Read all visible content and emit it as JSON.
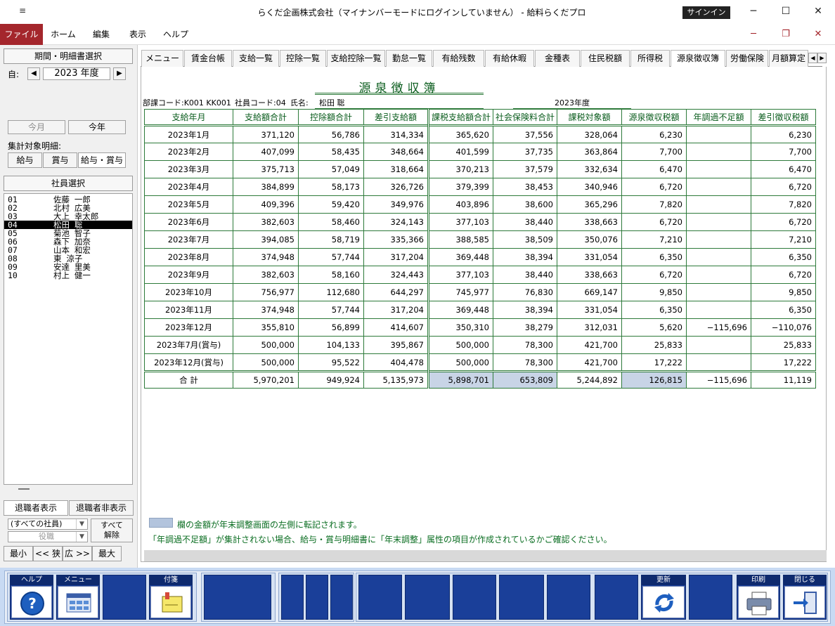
{
  "window": {
    "title": "らくだ企画株式会社（マイナンバーモードにログインしていません） - 給料らくだプロ",
    "signin": "サインイン",
    "qa_icon": "≡",
    "min": "─",
    "max": "☐",
    "close": "✕"
  },
  "menubar": {
    "items": [
      "ファイル",
      "ホーム",
      "編集",
      "表示",
      "ヘルプ"
    ],
    "mdi_min": "─",
    "mdi_restore": "❐",
    "mdi_close": "✕"
  },
  "left": {
    "period_header": "期間・明細書選択",
    "from_label": "自:",
    "year_value": "2023 年度",
    "prev": "◀",
    "next": "▶",
    "this_month": "今月",
    "this_year": "今年",
    "target_label": "集計対象明細:",
    "target_buttons": [
      "給与",
      "賞与",
      "給与・賞与"
    ],
    "employee_header": "社員選択",
    "employees": [
      {
        "code": "01",
        "name": "佐藤 一郎"
      },
      {
        "code": "02",
        "name": "北村 広美"
      },
      {
        "code": "03",
        "name": "大上 幸太郎"
      },
      {
        "code": "04",
        "name": "松田 聡"
      },
      {
        "code": "05",
        "name": "菊池 智子"
      },
      {
        "code": "06",
        "name": "森下 加奈"
      },
      {
        "code": "07",
        "name": "山本 和宏"
      },
      {
        "code": "08",
        "name": "東 涼子"
      },
      {
        "code": "09",
        "name": "安達 里美"
      },
      {
        "code": "10",
        "name": "村上 健一"
      }
    ],
    "show_retired": "退職者表示",
    "hide_retired": "退職者非表示",
    "filter_all": "(すべての社員)",
    "filter_role": "役職",
    "clear_all": "すべて\n解除",
    "size_buttons": [
      "最小",
      "<< 狭",
      "広 >>",
      "最大"
    ]
  },
  "tabs": [
    "メニュー",
    "賃金台帳",
    "支給一覧",
    "控除一覧",
    "支給控除一覧",
    "勤怠一覧",
    "有給残数",
    "有給休暇",
    "金種表",
    "住民税額",
    "所得税",
    "源泉徴収簿",
    "労働保険",
    "月額算定"
  ],
  "active_tab": "源泉徴収簿",
  "document": {
    "title": "源泉徴収簿",
    "dept": "部課コード:K001 KK001",
    "emp_code": "社員コード:04",
    "name_label": "氏名:",
    "name": "松田 聡",
    "year": "2023年度"
  },
  "table": {
    "headers": [
      "支給年月",
      "支給額合計",
      "控除額合計",
      "差引支給額",
      "課税支給額合計",
      "社会保険料合計",
      "課税対象額",
      "源泉徴収税額",
      "年調過不足額",
      "差引徴収税額"
    ],
    "rows": [
      [
        "2023年1月",
        "371,120",
        "56,786",
        "314,334",
        "365,620",
        "37,556",
        "328,064",
        "6,230",
        "",
        "6,230"
      ],
      [
        "2023年2月",
        "407,099",
        "58,435",
        "348,664",
        "401,599",
        "37,735",
        "363,864",
        "7,700",
        "",
        "7,700"
      ],
      [
        "2023年3月",
        "375,713",
        "57,049",
        "318,664",
        "370,213",
        "37,579",
        "332,634",
        "6,470",
        "",
        "6,470"
      ],
      [
        "2023年4月",
        "384,899",
        "58,173",
        "326,726",
        "379,399",
        "38,453",
        "340,946",
        "6,720",
        "",
        "6,720"
      ],
      [
        "2023年5月",
        "409,396",
        "59,420",
        "349,976",
        "403,896",
        "38,600",
        "365,296",
        "7,820",
        "",
        "7,820"
      ],
      [
        "2023年6月",
        "382,603",
        "58,460",
        "324,143",
        "377,103",
        "38,440",
        "338,663",
        "6,720",
        "",
        "6,720"
      ],
      [
        "2023年7月",
        "394,085",
        "58,719",
        "335,366",
        "388,585",
        "38,509",
        "350,076",
        "7,210",
        "",
        "7,210"
      ],
      [
        "2023年8月",
        "374,948",
        "57,744",
        "317,204",
        "369,448",
        "38,394",
        "331,054",
        "6,350",
        "",
        "6,350"
      ],
      [
        "2023年9月",
        "382,603",
        "58,160",
        "324,443",
        "377,103",
        "38,440",
        "338,663",
        "6,720",
        "",
        "6,720"
      ],
      [
        "2023年10月",
        "756,977",
        "112,680",
        "644,297",
        "745,977",
        "76,830",
        "669,147",
        "9,850",
        "",
        "9,850"
      ],
      [
        "2023年11月",
        "374,948",
        "57,744",
        "317,204",
        "369,448",
        "38,394",
        "331,054",
        "6,350",
        "",
        "6,350"
      ],
      [
        "2023年12月",
        "355,810",
        "56,899",
        "414,607",
        "350,310",
        "38,279",
        "312,031",
        "5,620",
        "−115,696",
        "−110,076"
      ],
      [
        "2023年7月(賞与)",
        "500,000",
        "104,133",
        "395,867",
        "500,000",
        "78,300",
        "421,700",
        "25,833",
        "",
        "25,833"
      ],
      [
        "2023年12月(賞与)",
        "500,000",
        "95,522",
        "404,478",
        "500,000",
        "78,300",
        "421,700",
        "17,222",
        "",
        "17,222"
      ]
    ],
    "total": [
      "合 計",
      "5,970,201",
      "949,924",
      "5,135,973",
      "5,898,701",
      "653,809",
      "5,244,892",
      "126,815",
      "−115,696",
      "11,119"
    ]
  },
  "legend_text": "欄の金額が年末調整画面の左側に転記されます。",
  "note_text": "「年調過不足額」が集計されない場合、給与・賞与明細書に「年末調整」属性の項目が作成されているかご確認ください。",
  "toolbar": {
    "help": "ヘルプ",
    "menu": "メニュー",
    "sticky": "付箋",
    "update": "更新",
    "print": "印刷",
    "close": "閉じる"
  },
  "colors": {
    "accent_green": "#0b5d1e",
    "highlight": "#c8d4e6",
    "file_menu": "#a4262c",
    "toolbar_blue": "#1a3f99"
  }
}
